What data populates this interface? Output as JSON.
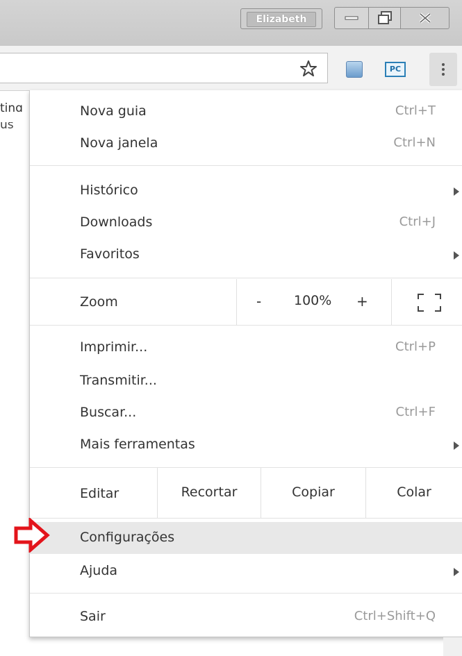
{
  "window": {
    "profile_name": "Elizabeth"
  },
  "page_fragments": {
    "text1": "tinɑ",
    "text2": "us"
  },
  "toolbar": {
    "extension2_label": "PC"
  },
  "menu": {
    "group1": [
      {
        "label": "Nova guia",
        "shortcut": "Ctrl+T"
      },
      {
        "label": "Nova janela",
        "shortcut": "Ctrl+N"
      }
    ],
    "group2": [
      {
        "label": "Histórico",
        "shortcut": ""
      },
      {
        "label": "Downloads",
        "shortcut": "Ctrl+J"
      },
      {
        "label": "Favoritos",
        "shortcut": ""
      }
    ],
    "zoom": {
      "label": "Zoom",
      "minus": "-",
      "value": "100%",
      "plus": "+"
    },
    "group3": [
      {
        "label": "Imprimir...",
        "shortcut": "Ctrl+P"
      },
      {
        "label": "Transmitir...",
        "shortcut": ""
      },
      {
        "label": "Buscar...",
        "shortcut": "Ctrl+F"
      },
      {
        "label": "Mais ferramentas",
        "shortcut": ""
      }
    ],
    "edit": {
      "label": "Editar",
      "cut": "Recortar",
      "copy": "Copiar",
      "paste": "Colar"
    },
    "group4": [
      {
        "label": "Configurações",
        "shortcut": ""
      },
      {
        "label": "Ajuda",
        "shortcut": ""
      }
    ],
    "group5": [
      {
        "label": "Sair",
        "shortcut": "Ctrl+Shift+Q"
      }
    ]
  },
  "colors": {
    "annotation_arrow": "#e3141b",
    "highlight": "#e8e8e8"
  }
}
